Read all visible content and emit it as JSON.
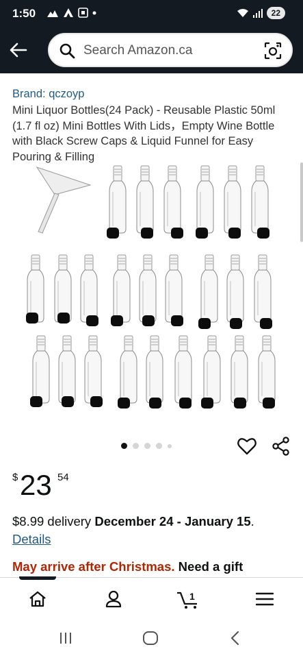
{
  "status_bar": {
    "time": "1:50",
    "battery": "22"
  },
  "search": {
    "placeholder": "Search Amazon.ca"
  },
  "product": {
    "brand": "Brand: qczoyp",
    "title": "Mini Liquor Bottles(24 Pack) - Reusable Plastic 50ml (1.7 fl oz) Mini Bottles With Lids，Empty Wine Bottle with Black Screw Caps & Liquid Funnel for Easy Pouring & Filling"
  },
  "gallery": {
    "image_count": 5,
    "active_index": 0
  },
  "price": {
    "symbol": "$",
    "whole": "23",
    "fraction": "54"
  },
  "delivery": {
    "prefix": "$8.99 delivery ",
    "dates": "December 24 - January 15",
    "suffix": ".",
    "details_link": "Details"
  },
  "gift": {
    "warning": "May arrive after Christmas.",
    "question": " Need a gift"
  },
  "bottom_nav": {
    "items": [
      {
        "icon": "home-icon"
      },
      {
        "icon": "account-icon"
      },
      {
        "icon": "cart-icon",
        "count": "1"
      },
      {
        "icon": "menu-icon"
      }
    ]
  },
  "colors": {
    "header_bg": "#131a22",
    "link": "#1f5a85",
    "alert": "#b12704"
  }
}
